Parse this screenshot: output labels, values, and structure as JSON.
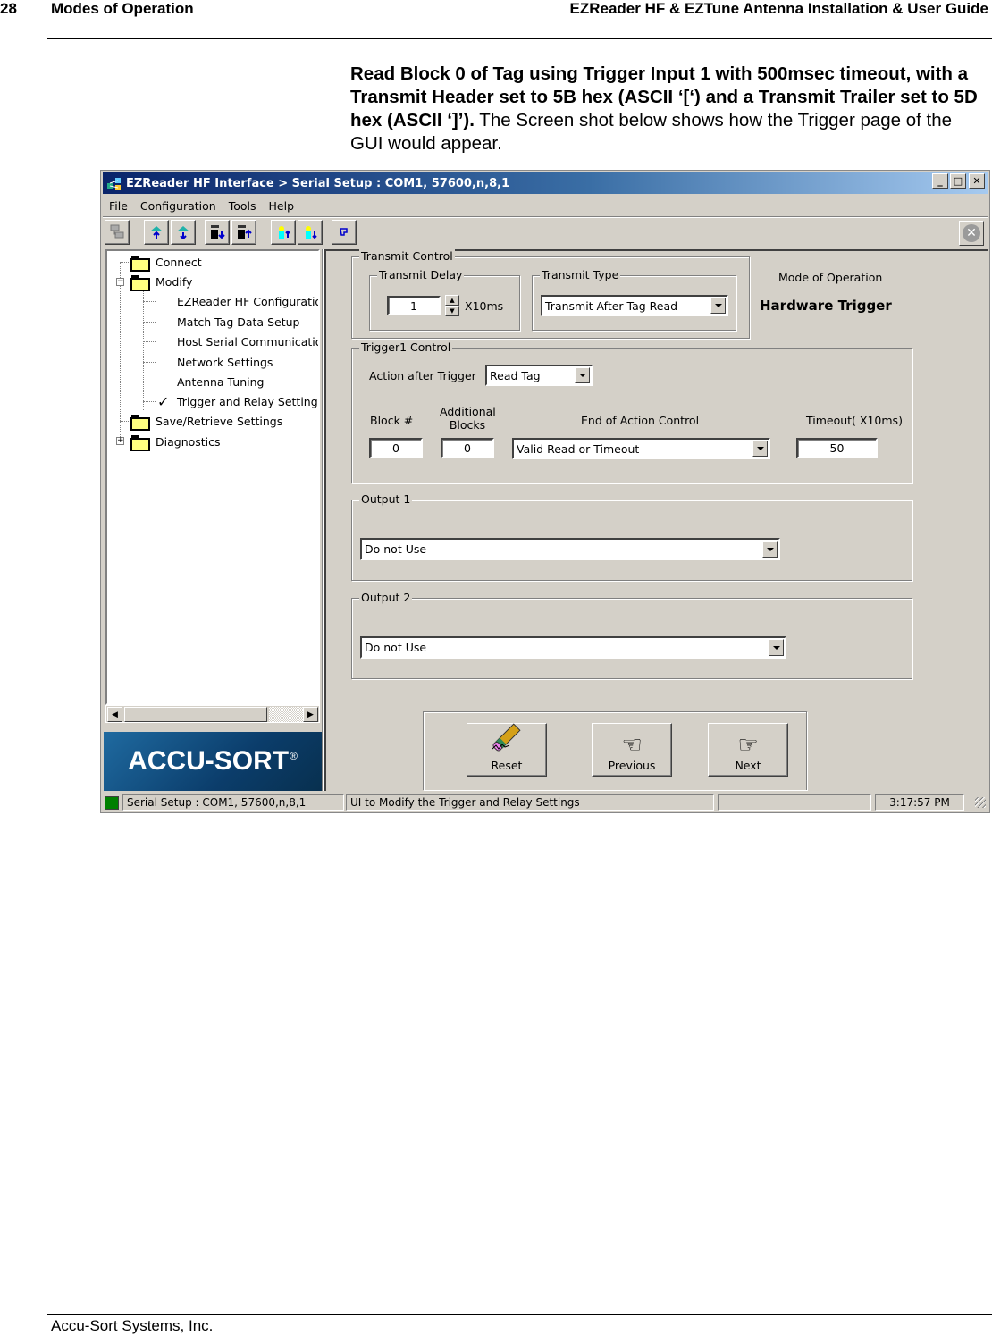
{
  "page": {
    "number": "28",
    "section": "Modes of Operation",
    "guide_title": "EZReader HF & EZTune Antenna Installation & User Guide",
    "footer": "Accu-Sort Systems, Inc."
  },
  "intro": {
    "bold_text": "Read Block 0 of Tag using Trigger Input 1 with 500msec timeout, with a Transmit Header set to 5B hex (ASCII ‘[‘) and a Transmit Trailer set to 5D hex (ASCII ‘]’).",
    "plain_text": " The Screen shot below shows how the Trigger page of the GUI would appear."
  },
  "window": {
    "title": "EZReader HF Interface > Serial Setup : COM1, 57600,n,8,1",
    "controls": {
      "minimize": "_",
      "maximize": "□",
      "close": "✕"
    },
    "menu": [
      "File",
      "Configuration",
      "Tools",
      "Help"
    ],
    "toolbar": [
      {
        "name": "network-icon"
      },
      {
        "name": "upload-cloud-icon"
      },
      {
        "name": "download-cloud-icon"
      },
      {
        "name": "device-download-icon"
      },
      {
        "name": "device-upload-icon"
      },
      {
        "name": "user-upload-icon"
      },
      {
        "name": "user-download-icon"
      },
      {
        "name": "pointer-icon"
      }
    ],
    "exit_icon": "✕",
    "tree": {
      "items": [
        {
          "label": "Connect",
          "type": "folder",
          "level": 0
        },
        {
          "label": "Modify",
          "type": "folder",
          "level": 0,
          "expanded": true
        },
        {
          "label": "EZReader HF Configuratio",
          "type": "leaf",
          "level": 1
        },
        {
          "label": "Match Tag Data Setup",
          "type": "leaf",
          "level": 1
        },
        {
          "label": "Host Serial Communication",
          "type": "leaf",
          "level": 1
        },
        {
          "label": "Network Settings",
          "type": "leaf",
          "level": 1
        },
        {
          "label": "Antenna Tuning",
          "type": "leaf",
          "level": 1
        },
        {
          "label": "Trigger and Relay Settings",
          "type": "leaf",
          "level": 1,
          "checked": true
        },
        {
          "label": "Save/Retrieve Settings",
          "type": "folder",
          "level": 0
        },
        {
          "label": "Diagnostics",
          "type": "folder",
          "level": 0,
          "expanded": false
        }
      ]
    },
    "logo": {
      "text": "ACCU-SORT",
      "mark": "®"
    },
    "transmit_control": {
      "label": "Transmit Control",
      "delay": {
        "label": "Transmit Delay",
        "value": "1",
        "unit": "X10ms"
      },
      "type": {
        "label": "Transmit Type",
        "value": "Transmit After Tag Read"
      }
    },
    "mode": {
      "label": "Mode of Operation",
      "value": "Hardware Trigger"
    },
    "trigger1": {
      "label": "Trigger1 Control",
      "action_label": "Action after Trigger",
      "action_value": "Read Tag",
      "block_label": "Block #",
      "block_value": "0",
      "additional_label_1": "Additional",
      "additional_label_2": "Blocks",
      "additional_value": "0",
      "end_label": "End of Action Control",
      "end_value": "Valid Read or Timeout",
      "timeout_label": "Timeout( X10ms)",
      "timeout_value": "50"
    },
    "output1": {
      "label": "Output 1",
      "value": "Do not Use"
    },
    "output2": {
      "label": "Output 2",
      "value": "Do not Use"
    },
    "buttons": {
      "reset": "Reset",
      "previous": "Previous",
      "next": "Next"
    },
    "status": {
      "connection": "Serial Setup : COM1, 57600,n,8,1",
      "message": "UI to Modify the Trigger and Relay Settings",
      "progress": 0,
      "time": "3:17:57 PM",
      "led_color": "#008000"
    }
  }
}
